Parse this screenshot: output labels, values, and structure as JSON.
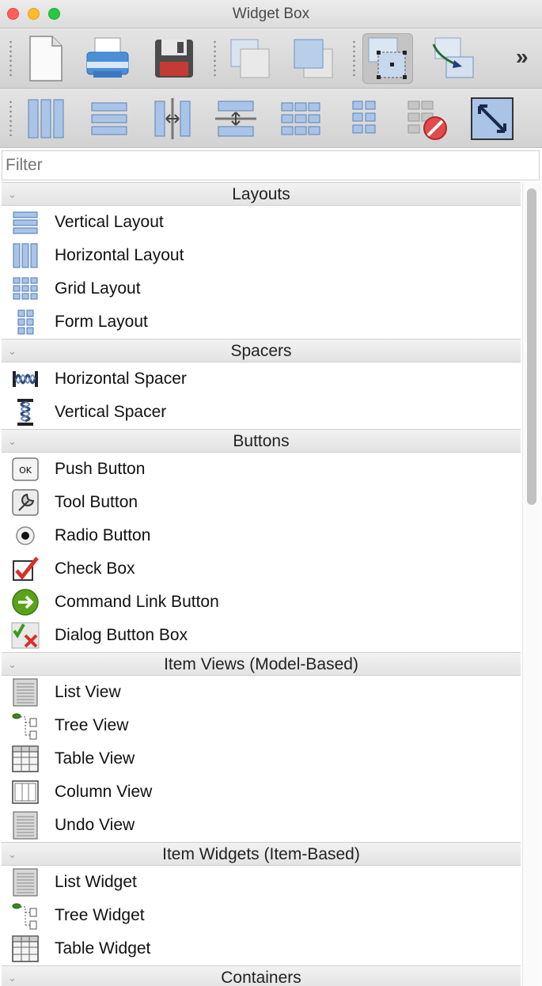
{
  "window": {
    "title": "Widget Box"
  },
  "toolbar_row1": [
    {
      "icon": "new-document-icon"
    },
    {
      "icon": "print-icon"
    },
    {
      "icon": "save-icon"
    },
    {
      "icon": "send-to-back-icon"
    },
    {
      "icon": "bring-to-front-icon"
    },
    {
      "icon": "edit-widgets-icon"
    },
    {
      "icon": "edit-signals-slots-icon"
    }
  ],
  "toolbar_row2": [
    {
      "icon": "layout-horizontal-icon"
    },
    {
      "icon": "layout-vertical-icon"
    },
    {
      "icon": "layout-horizontal-splitter-icon"
    },
    {
      "icon": "layout-vertical-splitter-icon"
    },
    {
      "icon": "layout-grid-icon"
    },
    {
      "icon": "layout-form-icon"
    },
    {
      "icon": "break-layout-icon"
    },
    {
      "icon": "adjust-size-icon"
    }
  ],
  "overflow_glyph": "»",
  "filter": {
    "placeholder": "Filter"
  },
  "categories": [
    {
      "title": "Layouts",
      "items": [
        "Vertical Layout",
        "Horizontal Layout",
        "Grid Layout",
        "Form Layout"
      ]
    },
    {
      "title": "Spacers",
      "items": [
        "Horizontal Spacer",
        "Vertical Spacer"
      ]
    },
    {
      "title": "Buttons",
      "items": [
        "Push Button",
        "Tool Button",
        "Radio Button",
        "Check Box",
        "Command Link Button",
        "Dialog Button Box"
      ]
    },
    {
      "title": "Item Views (Model-Based)",
      "items": [
        "List View",
        "Tree View",
        "Table View",
        "Column View",
        "Undo View"
      ]
    },
    {
      "title": "Item Widgets (Item-Based)",
      "items": [
        "List Widget",
        "Tree Widget",
        "Table Widget"
      ]
    },
    {
      "title": "Containers",
      "items": []
    }
  ],
  "colors": {
    "accent_blue": "#4a8fd8",
    "red": "#d9302b",
    "green": "#5aa21a"
  }
}
